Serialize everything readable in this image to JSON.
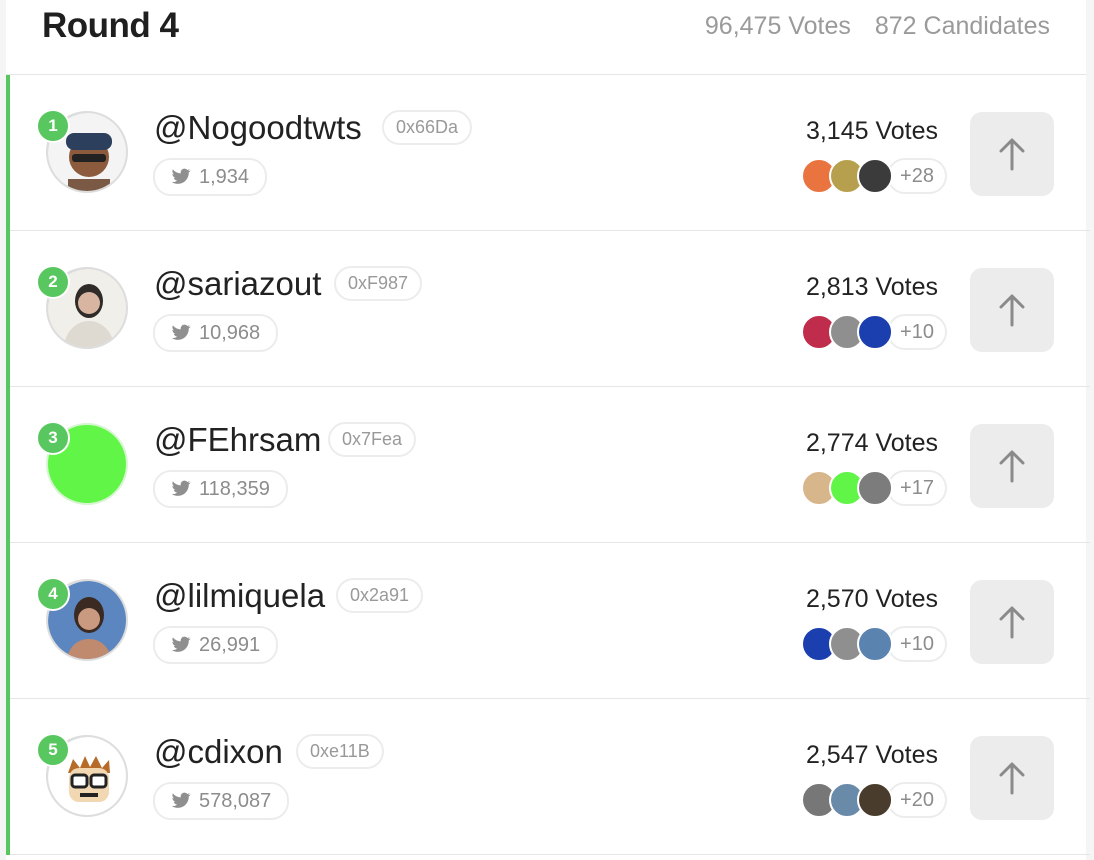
{
  "header": {
    "title": "Round 4",
    "total_votes": "96,475 Votes",
    "total_candidates": "872 Candidates"
  },
  "candidates": [
    {
      "rank": "1",
      "handle": "@Nogoodtwts",
      "address": "0x66Da",
      "followers": "1,934",
      "votes": "3,145 Votes",
      "more_voters": "+28",
      "avatar_color": "#8c5a3c",
      "voter_colors": [
        "#e9743f",
        "#b6a04d",
        "#3b3b3b"
      ]
    },
    {
      "rank": "2",
      "handle": "@sariazout",
      "address": "0xF987",
      "followers": "10,968",
      "votes": "2,813 Votes",
      "more_voters": "+10",
      "avatar_color": "#e7e2db",
      "voter_colors": [
        "#c02d4c",
        "#8f8f8f",
        "#1b3fae"
      ]
    },
    {
      "rank": "3",
      "handle": "@FEhrsam",
      "address": "0x7Fea",
      "followers": "118,359",
      "votes": "2,774 Votes",
      "more_voters": "+17",
      "avatar_color": "#61f548",
      "voter_colors": [
        "#d7b68b",
        "#61f548",
        "#7c7c7c"
      ]
    },
    {
      "rank": "4",
      "handle": "@lilmiquela",
      "address": "0x2a91",
      "followers": "26,991",
      "votes": "2,570 Votes",
      "more_voters": "+10",
      "avatar_color": "#5b86bf",
      "voter_colors": [
        "#1b3fae",
        "#8f8f8f",
        "#5a83b0"
      ]
    },
    {
      "rank": "5",
      "handle": "@cdixon",
      "address": "0xe11B",
      "followers": "578,087",
      "votes": "2,547 Votes",
      "more_voters": "+20",
      "avatar_color": "#f3e1bd",
      "voter_colors": [
        "#777777",
        "#6a8aaa",
        "#4a3c2c"
      ]
    }
  ],
  "colors": {
    "accent": "#59c760",
    "button_bg": "#ececec"
  },
  "icons": {
    "social": "twitter-icon",
    "upvote": "arrow-up-icon"
  }
}
